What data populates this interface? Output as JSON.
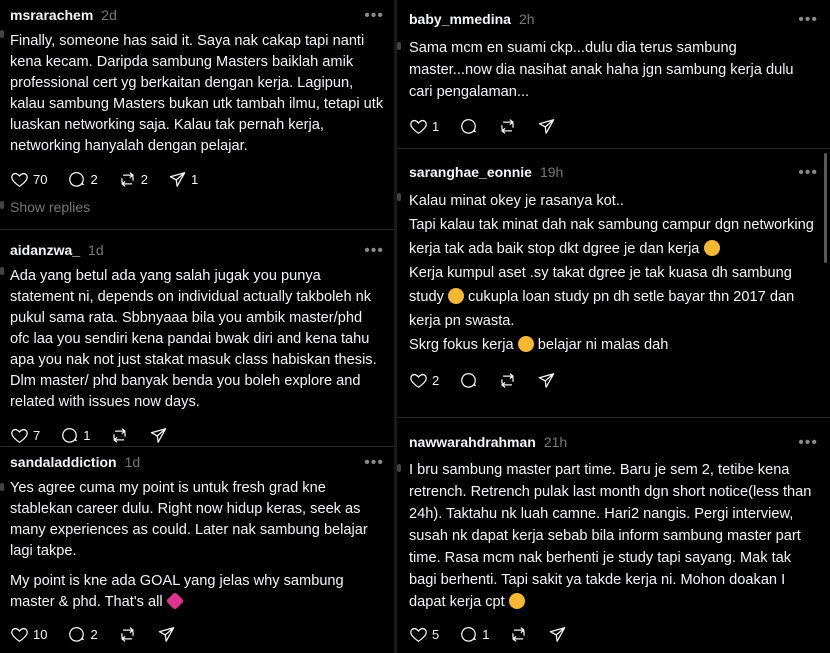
{
  "left_posts": [
    {
      "user": "msrarachem",
      "time": "2d",
      "paragraphs": [
        "Finally, someone has said it. Saya nak cakap tapi nanti kena kecam. Daripda sambung Masters baiklah amik professional cert yg berkaitan dengan kerja. Lagipun, kalau sambung Masters bukan utk tambah ilmu, tetapi utk luaskan networking saja. Kalau tak pernah kerja, networking hanyalah dengan pelajar."
      ],
      "likes": "70",
      "replies": "2",
      "reposts": "2",
      "shares": "1"
    },
    {
      "user": "aidanzwa_",
      "time": "1d",
      "paragraphs": [
        "Ada yang betul ada yang salah jugak you punya statement ni, depends on individual actually takboleh nk pukul sama rata. Sbbnyaaa bila you ambik master/phd ofc laa you sendiri kena pandai bwak diri and kena tahu apa you nak not just stakat masuk class habiskan thesis. Dlm master/ phd banyak benda you boleh explore and related with issues now days."
      ],
      "likes": "7",
      "replies": "1",
      "reposts": "",
      "shares": ""
    },
    {
      "user": "sandaladdiction",
      "time": "1d",
      "paragraphs": [
        "Yes agree cuma my point is untuk fresh grad kne stablekan career dulu. Right now hidup keras, seek as many experiences as could. Later nak sambung belajar lagi takpe.",
        "My point is kne ada GOAL yang jelas why sambung master & phd. That's all"
      ],
      "likes": "10",
      "replies": "2",
      "reposts": "",
      "shares": ""
    }
  ],
  "show_replies": "Show replies",
  "right_posts": [
    {
      "user": "baby_mmedina",
      "time": "2h",
      "paragraphs": [
        "Sama mcm en suami ckp...dulu dia terus sambung master...now dia nasihat anak haha jgn sambung kerja dulu cari pengalaman..."
      ],
      "likes": "1",
      "replies": "",
      "reposts": "",
      "shares": ""
    },
    {
      "user": "saranghae_eonnie",
      "time": "19h",
      "paragraphs": [
        "Kalau minat okey je rasanya kot..",
        "Tapi kalau tak minat dah nak sambung campur dgn networking kerja tak ada baik stop dkt dgree je dan kerja",
        "Kerja kumpul aset .sy takat dgree je tak kuasa dh sambung study",
        "cukupla loan study pn dh setle bayar thn 2017 dan kerja pn swasta.",
        "Skrg fokus kerja",
        "belajar ni malas dah"
      ],
      "likes": "2",
      "replies": "",
      "reposts": "",
      "shares": ""
    },
    {
      "user": "nawwarahdrahman",
      "time": "21h",
      "paragraphs": [
        "I bru sambung master part time. Baru je sem 2, tetibe kena retrench. Retrench pulak last month dgn short notice(less than 24h). Taktahu nk luah camne. Hari2 nangis. Pergi interview, susah nk dapat kerja sebab bila inform sambung master part time. Rasa mcm nak berhenti je study tapi sayang. Mak tak bagi berhenti. Tapi sakit ya takde kerja ni. Mohon doakan I dapat kerja cpt"
      ],
      "likes": "5",
      "replies": "1",
      "reposts": "",
      "shares": ""
    }
  ],
  "icons": [
    "heart-icon",
    "comment-icon",
    "repost-icon",
    "share-icon",
    "more-icon"
  ],
  "colors": {
    "background": "#000000",
    "text": "#f3f5f7",
    "muted": "#777777",
    "heart_emoji": "#e0338f",
    "smile_emoji": "#f5b82e"
  }
}
